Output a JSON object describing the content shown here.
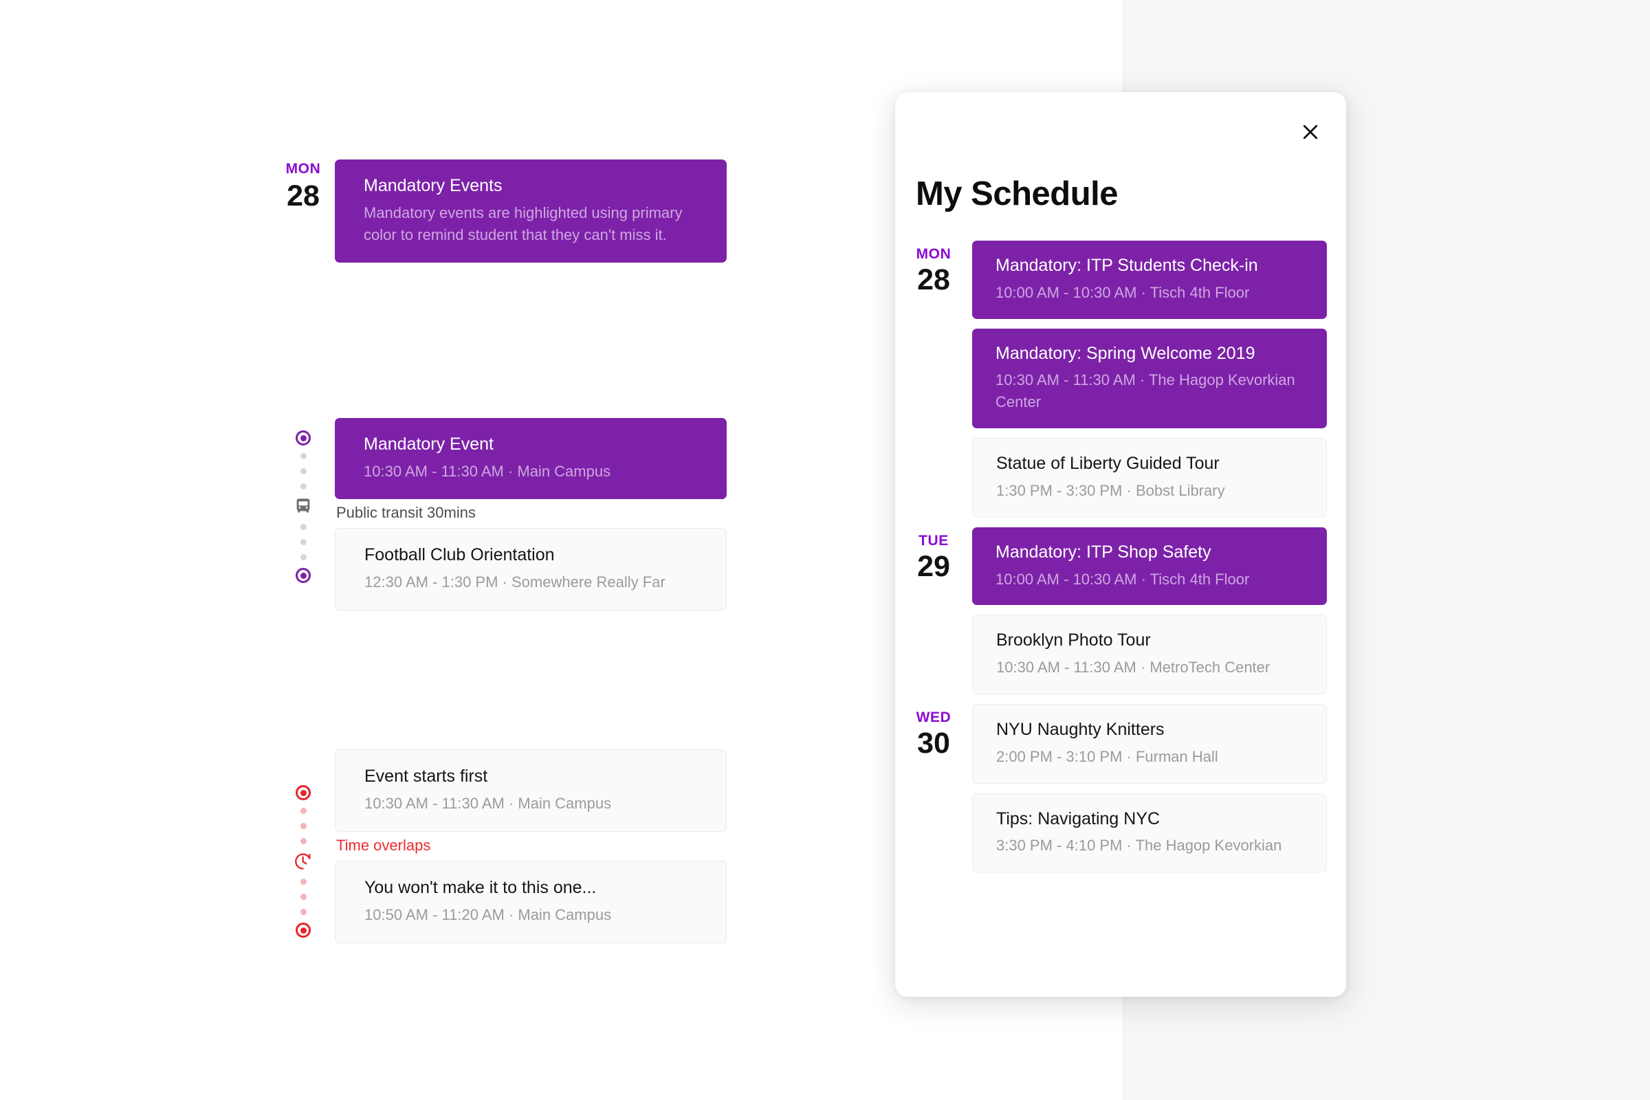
{
  "theme": {
    "primary": "#7d22a8",
    "accent_day": "#8b0ad4",
    "danger": "#e8232a",
    "card_plain_bg": "#fafafa",
    "backdrop": "#f5f6f7"
  },
  "spec": {
    "groups": [
      {
        "day": {
          "dow": "MON",
          "num": "28"
        },
        "rail": null,
        "cards": [
          {
            "style": "purple",
            "title": "Mandatory Events",
            "subtitle": "Mandatory events are highlighted using primary color to remind student that they can't miss it."
          }
        ]
      },
      {
        "day": null,
        "rail": {
          "type": "transit",
          "icon": "bus-icon",
          "color": "#7d22a8"
        },
        "note": {
          "text": "Public transit 30mins",
          "tone": "neutral"
        },
        "cards": [
          {
            "style": "purple",
            "title": "Mandatory Event",
            "subtitle": "10:30 AM - 11:30 AM · Main Campus"
          },
          {
            "style": "plain",
            "title": "Football Club Orientation",
            "subtitle": "12:30 AM - 1:30 PM · Somewhere Really Far"
          }
        ]
      },
      {
        "day": null,
        "rail": {
          "type": "overlap",
          "icon": "clock-history-icon",
          "color": "#e8232a"
        },
        "note": {
          "text": "Time overlaps",
          "tone": "danger"
        },
        "cards": [
          {
            "style": "plain",
            "title": "Event starts first",
            "subtitle": "10:30 AM - 11:30 AM · Main Campus"
          },
          {
            "style": "plain",
            "title": "You won't make it to this one...",
            "subtitle": "10:50 AM - 11:20 AM · Main Campus"
          }
        ]
      }
    ]
  },
  "sheet": {
    "title": "My Schedule",
    "close_icon": "close-icon",
    "rows": [
      {
        "day": {
          "dow": "MON",
          "num": "28"
        },
        "style": "purple",
        "title": "Mandatory: ITP Students Check-in",
        "subtitle": "10:00 AM - 10:30 AM · Tisch 4th Floor"
      },
      {
        "day": null,
        "style": "purple",
        "title": "Mandatory: Spring Welcome 2019",
        "subtitle": "10:30 AM - 11:30 AM · The Hagop Kevorkian Center"
      },
      {
        "day": null,
        "style": "plain",
        "title": "Statue of Liberty Guided Tour",
        "subtitle": "1:30 PM - 3:30 PM · Bobst Library"
      },
      {
        "day": {
          "dow": "TUE",
          "num": "29"
        },
        "style": "purple",
        "title": "Mandatory: ITP Shop Safety",
        "subtitle": "10:00 AM - 10:30 AM · Tisch 4th Floor"
      },
      {
        "day": null,
        "style": "plain",
        "title": "Brooklyn Photo Tour",
        "subtitle": "10:30 AM - 11:30 AM · MetroTech Center"
      },
      {
        "day": {
          "dow": "WED",
          "num": "30"
        },
        "style": "plain",
        "title": "NYU Naughty Knitters",
        "subtitle": "2:00 PM - 3:10 PM · Furman Hall"
      },
      {
        "day": null,
        "style": "plain",
        "title": "Tips: Navigating NYC",
        "subtitle": "3:30 PM - 4:10 PM · The Hagop Kevorkian"
      }
    ]
  }
}
